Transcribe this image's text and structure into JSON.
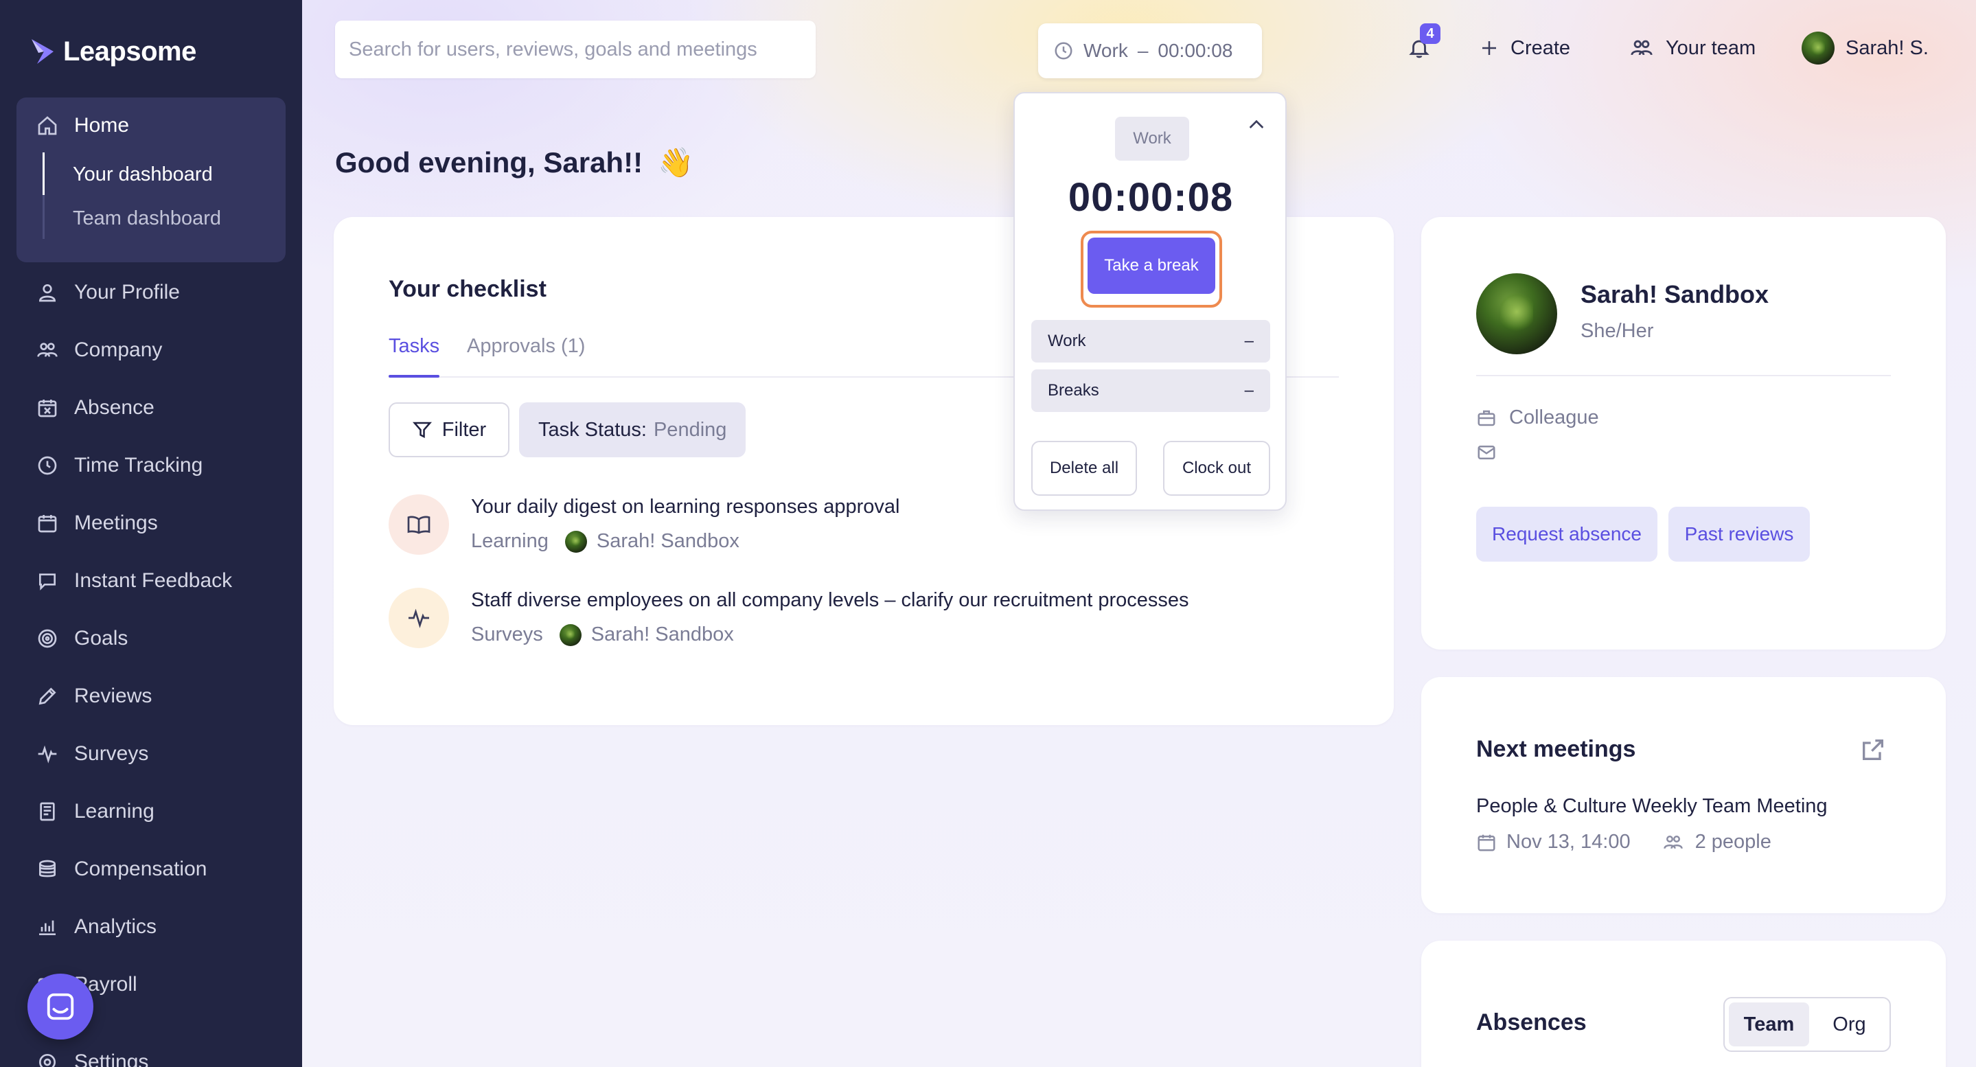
{
  "app": {
    "logo_text": "Leapsome"
  },
  "sidebar": {
    "home": {
      "label": "Home",
      "sub": [
        {
          "label": "Your dashboard"
        },
        {
          "label": "Team dashboard"
        }
      ]
    },
    "items": [
      {
        "label": "Your Profile",
        "icon": "user-icon"
      },
      {
        "label": "Company",
        "icon": "users-icon"
      },
      {
        "label": "Absence",
        "icon": "calendar-x-icon"
      },
      {
        "label": "Time Tracking",
        "icon": "clock-icon"
      },
      {
        "label": "Meetings",
        "icon": "calendar-icon"
      },
      {
        "label": "Instant Feedback",
        "icon": "chat-icon"
      },
      {
        "label": "Goals",
        "icon": "target-icon"
      },
      {
        "label": "Reviews",
        "icon": "pencil-icon"
      },
      {
        "label": "Surveys",
        "icon": "pulse-icon"
      },
      {
        "label": "Learning",
        "icon": "book-icon"
      },
      {
        "label": "Compensation",
        "icon": "coins-icon"
      },
      {
        "label": "Analytics",
        "icon": "chart-icon"
      },
      {
        "label": "Payroll",
        "icon": "payroll-icon"
      },
      {
        "label": "Settings",
        "icon": "gear-icon"
      }
    ]
  },
  "topbar": {
    "search_placeholder": "Search for users, reviews, goals and meetings",
    "timer_label": "Work",
    "timer_sep": "–",
    "timer_value": "00:00:08",
    "notification_count": "4",
    "create_label": "Create",
    "team_label": "Your team",
    "user_label": "Sarah! S."
  },
  "greeting": {
    "text": "Good evening, Sarah!!",
    "emoji": "👋"
  },
  "checklist": {
    "title": "Your checklist",
    "tabs": [
      {
        "label": "Tasks"
      },
      {
        "label": "Approvals (1)"
      }
    ],
    "filter_label": "Filter",
    "status_key": "Task Status:",
    "status_value": "Pending",
    "tasks": [
      {
        "title": "Your daily digest on learning responses approval",
        "category": "Learning",
        "person": "Sarah! Sandbox",
        "icon": "book-icon"
      },
      {
        "title": "Staff diverse employees on all company levels – clarify our recruitment processes",
        "category": "Surveys",
        "person": "Sarah! Sandbox",
        "icon": "pulse-icon"
      }
    ]
  },
  "profile": {
    "name": "Sarah! Sandbox",
    "pronouns": "She/Her",
    "role": "Colleague",
    "request_absence": "Request absence",
    "past_reviews": "Past reviews"
  },
  "meetings": {
    "title": "Next meetings",
    "item_title": "People & Culture Weekly Team Meeting",
    "item_date": "Nov 13, 14:00",
    "item_people": "2 people"
  },
  "absences": {
    "title": "Absences",
    "segments": [
      {
        "label": "Team"
      },
      {
        "label": "Org"
      }
    ]
  },
  "timer_popover": {
    "mode": "Work",
    "time": "00:00:08",
    "break_button": "Take a break",
    "rows": [
      {
        "label": "Work",
        "value": "–"
      },
      {
        "label": "Breaks",
        "value": "–"
      }
    ],
    "delete_all": "Delete all",
    "clock_out": "Clock out"
  },
  "colors": {
    "sidebar": "#222543",
    "accent": "#6b5cf0",
    "highlight": "#ee8a4f"
  }
}
